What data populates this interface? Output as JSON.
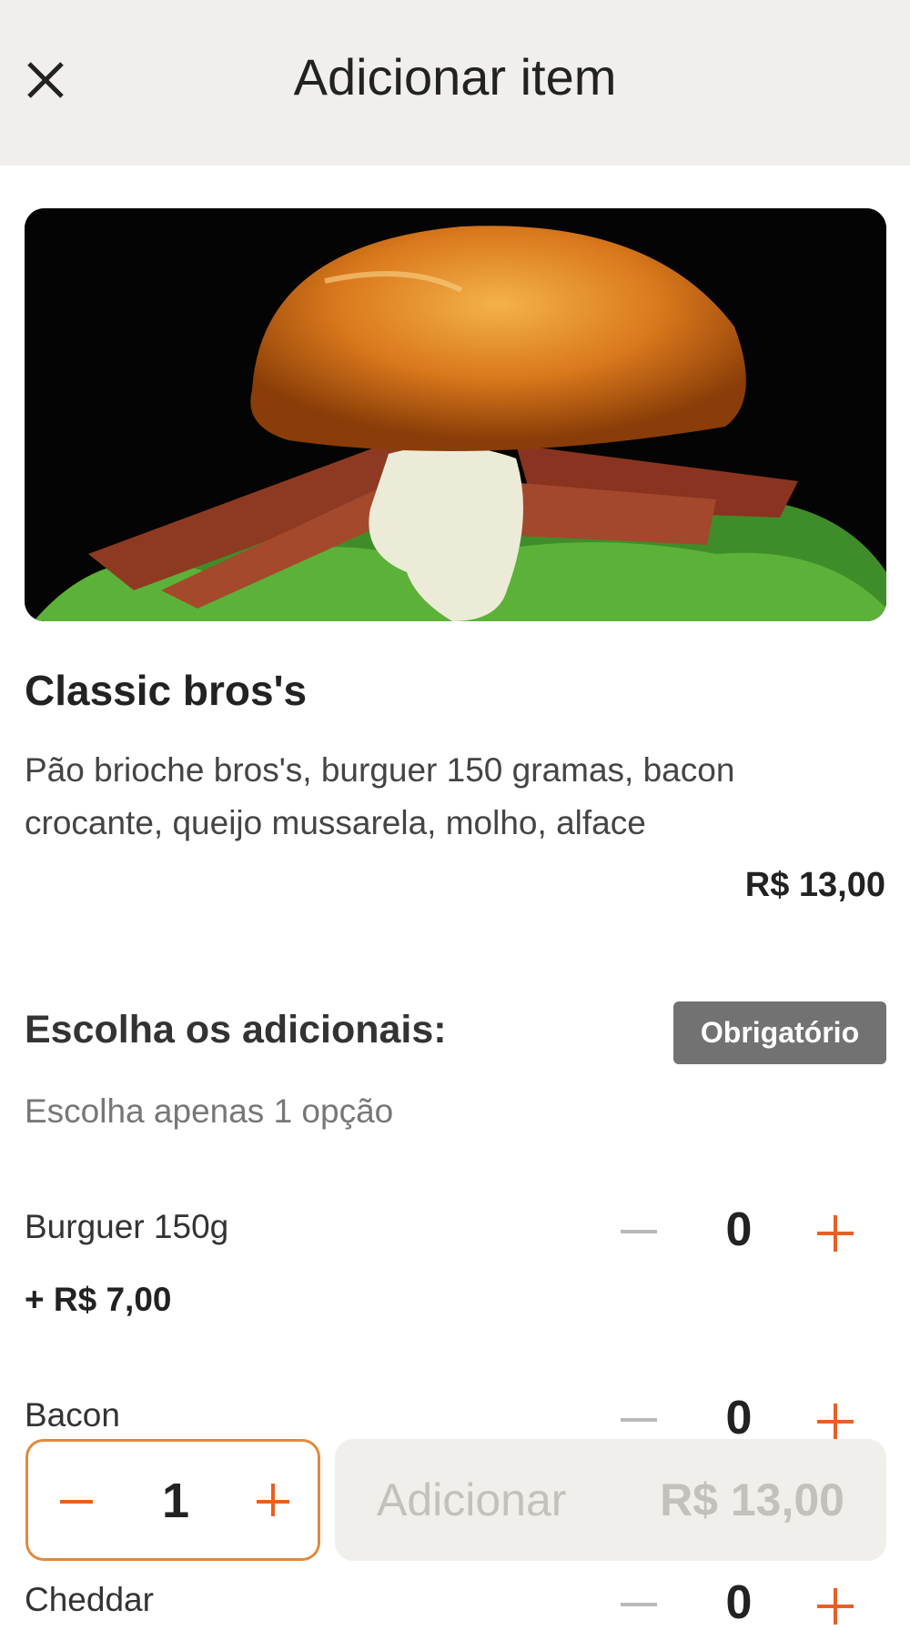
{
  "header": {
    "title": "Adicionar item",
    "close_icon": "close-icon"
  },
  "product": {
    "name": "Classic bros's",
    "description": "Pão brioche bros's, burguer 150 gramas, bacon crocante, queijo mussarela, molho, alface",
    "price": "R$ 13,00"
  },
  "addons": {
    "title": "Escolha os adicionais:",
    "badge": "Obrigatório",
    "subtitle": "Escolha apenas 1 opção",
    "options": [
      {
        "name": "Burguer 150g",
        "price": "+ R$ 7,00",
        "quantity": "0"
      },
      {
        "name": "Bacon",
        "quantity": "0"
      },
      {
        "name": "Cheddar",
        "quantity": "0"
      }
    ]
  },
  "footer": {
    "quantity": "1",
    "add_label": "Adicionar",
    "add_price": "R$ 13,00"
  },
  "colors": {
    "accent": "#e85f25",
    "header_bg": "#f1efeb",
    "badge_bg": "#727272"
  }
}
